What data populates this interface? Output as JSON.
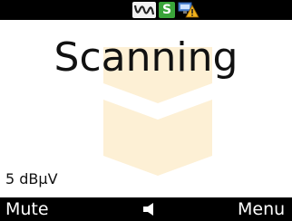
{
  "status": {
    "icons": [
      "wave-icon",
      "s-icon",
      "network-warning-icon"
    ],
    "s_label": "S"
  },
  "main": {
    "title": "Scanning",
    "signal_level": "5 dBμV"
  },
  "softkeys": {
    "left": "Mute",
    "center_icon": "speaker-icon",
    "right": "Menu"
  },
  "colors": {
    "bar": "#000000",
    "background": "#ffffff",
    "s_badge": "#3aa53a",
    "watermark": "#fdf0d5"
  }
}
